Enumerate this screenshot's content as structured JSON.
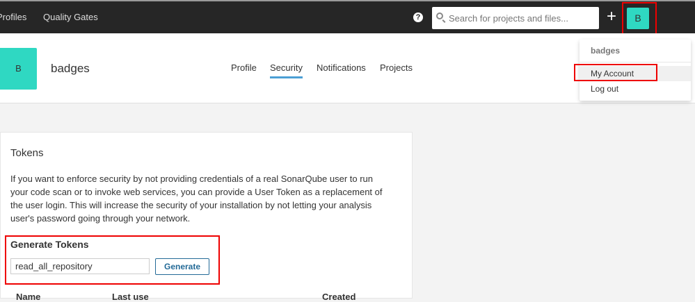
{
  "topnav": {
    "items": [
      "Profiles",
      "Quality Gates"
    ],
    "help": "?",
    "search_placeholder": "Search for projects and files...",
    "plus": "+",
    "avatar_letter": "B"
  },
  "header": {
    "avatar_letter": "B",
    "username": "badges",
    "tabs": [
      "Profile",
      "Security",
      "Notifications",
      "Projects"
    ],
    "active_tab": "Security"
  },
  "dropdown": {
    "header": "badges",
    "items": [
      "My Account",
      "Log out"
    ]
  },
  "tokens": {
    "title": "Tokens",
    "description": "If you want to enforce security by not providing credentials of a real SonarQube user to run your code scan or to invoke web services, you can provide a User Token as a replacement of the user login. This will increase the security of your installation by not letting your analysis user's password going through your network.",
    "generate_title": "Generate Tokens",
    "token_name_value": "read_all_repository",
    "generate_label": "Generate",
    "columns": [
      "Name",
      "Last use",
      "Created"
    ]
  }
}
